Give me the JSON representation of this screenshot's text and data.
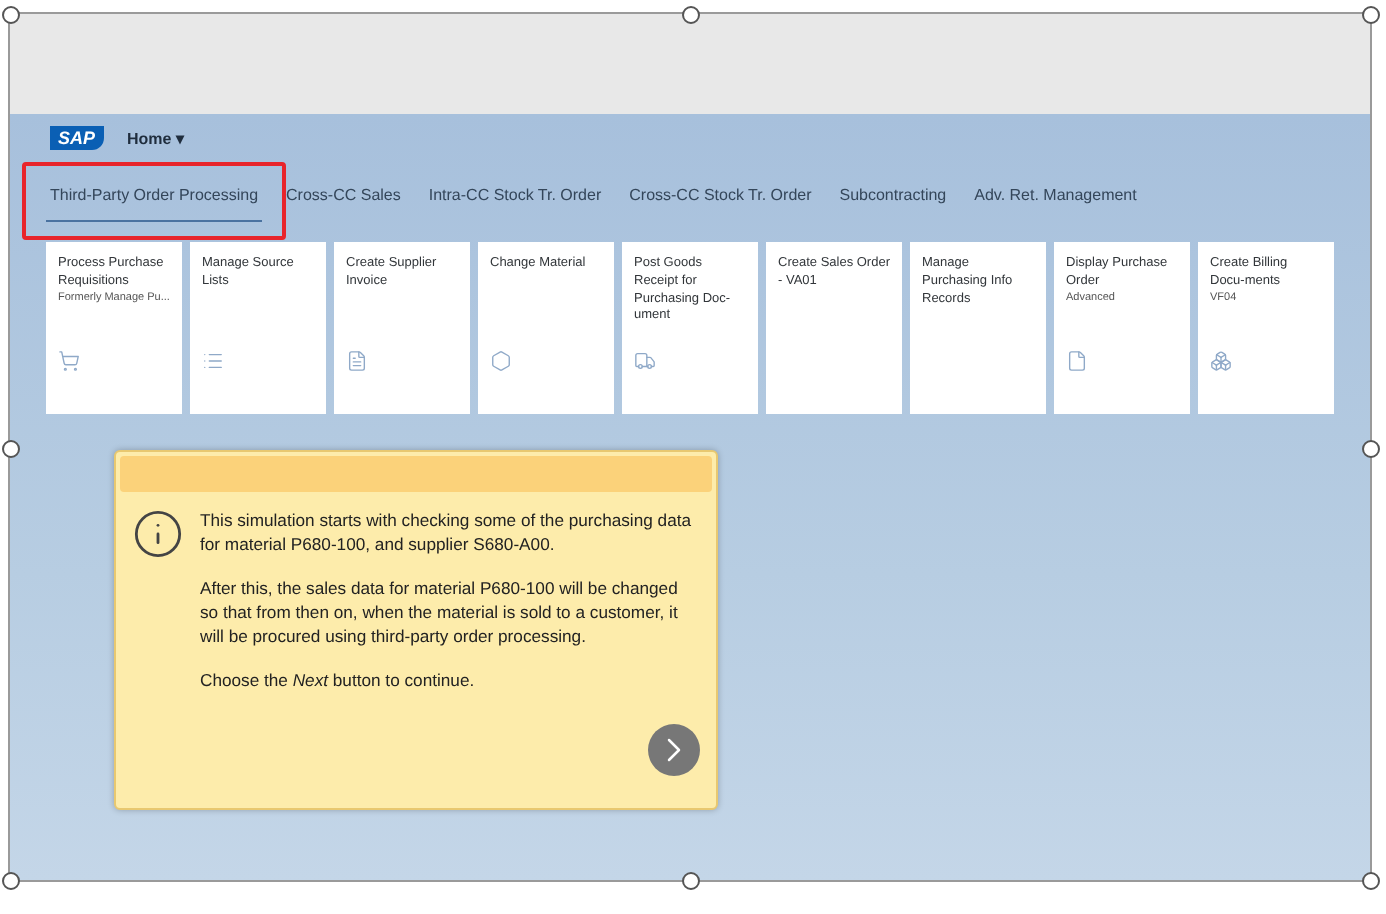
{
  "shell": {
    "logo": "SAP",
    "home_menu": "Home ▾"
  },
  "tabs": [
    {
      "label": "Third-Party Order Processing",
      "selected": true,
      "highlighted": true
    },
    {
      "label": "Cross-CC Sales",
      "selected": false,
      "highlighted": false
    },
    {
      "label": "Intra-CC Stock Tr. Order",
      "selected": false,
      "highlighted": false
    },
    {
      "label": "Cross-CC Stock Tr. Order",
      "selected": false,
      "highlighted": false
    },
    {
      "label": "Subcontracting",
      "selected": false,
      "highlighted": false
    },
    {
      "label": "Adv. Ret. Management",
      "selected": false,
      "highlighted": false
    }
  ],
  "tiles": [
    {
      "title": "Process Purchase Requisitions",
      "subtitle": "Formerly Manage Pu...",
      "kind": "cart"
    },
    {
      "title": "Manage Source Lists",
      "kind": "list"
    },
    {
      "title": "Create Supplier Invoice",
      "kind": "invoice"
    },
    {
      "title": "Change Material",
      "kind": "material"
    },
    {
      "title": "Post Goods Receipt for Purchasing Doc-ument",
      "kind": "truck"
    },
    {
      "title": "Create Sales Order - VA01",
      "kind": "plain"
    },
    {
      "title": "Manage Purchasing Info Records",
      "kind": "plain"
    },
    {
      "title": "Display Purchase Order",
      "subtitle": "Advanced",
      "kind": "document"
    },
    {
      "title": "Create Billing Docu-ments",
      "subtitle": "VF04",
      "kind": "boxes"
    }
  ],
  "dialog": {
    "paragraphs": [
      "This simulation starts with checking some of the purchasing data for material P680-100, and supplier S680-A00.",
      "After this, the sales data for material P680-100 will be changed so that from then on, when the material is sold to a customer, it will be procured using third-party order processing.",
      "Choose the *Next* button to continue."
    ]
  }
}
